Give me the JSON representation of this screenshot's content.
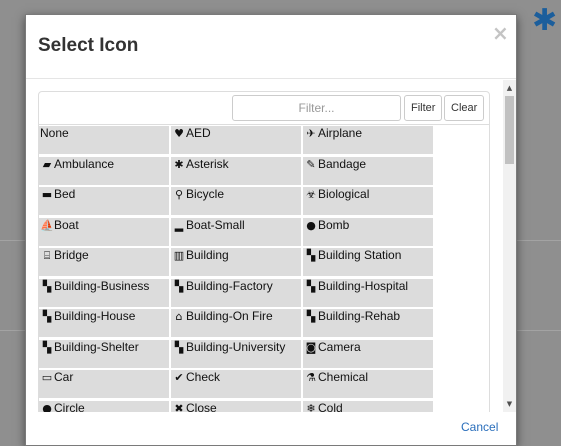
{
  "modal": {
    "title": "Select Icon",
    "close_label": "×",
    "cancel_label": "Cancel"
  },
  "filter": {
    "placeholder": "Filter...",
    "filter_button": "Filter",
    "clear_button": "Clear"
  },
  "icons": [
    {
      "label": "None",
      "icon": ""
    },
    {
      "label": "AED",
      "icon": "heart-pulse-icon"
    },
    {
      "label": "Airplane",
      "icon": "airplane-icon"
    },
    {
      "label": "Ambulance",
      "icon": "ambulance-icon"
    },
    {
      "label": "Asterisk",
      "icon": "asterisk-icon"
    },
    {
      "label": "Bandage",
      "icon": "bandage-icon"
    },
    {
      "label": "Bed",
      "icon": "bed-icon"
    },
    {
      "label": "Bicycle",
      "icon": "bicycle-icon"
    },
    {
      "label": "Biological",
      "icon": "biohazard-icon"
    },
    {
      "label": "Boat",
      "icon": "boat-icon"
    },
    {
      "label": "Boat-Small",
      "icon": "small-boat-icon"
    },
    {
      "label": "Bomb",
      "icon": "bomb-icon"
    },
    {
      "label": "Bridge",
      "icon": "bridge-icon"
    },
    {
      "label": "Building",
      "icon": "building-icon"
    },
    {
      "label": "Building Station",
      "icon": "building-station-icon"
    },
    {
      "label": "Building-Business",
      "icon": "building-business-icon"
    },
    {
      "label": "Building-Factory",
      "icon": "building-factory-icon"
    },
    {
      "label": "Building-Hospital",
      "icon": "building-hospital-icon"
    },
    {
      "label": "Building-House",
      "icon": "building-house-icon"
    },
    {
      "label": "Building-On Fire",
      "icon": "house-icon"
    },
    {
      "label": "Building-Rehab",
      "icon": "building-rehab-icon"
    },
    {
      "label": "Building-Shelter",
      "icon": "building-shelter-icon"
    },
    {
      "label": "Building-University",
      "icon": "building-university-icon"
    },
    {
      "label": "Camera",
      "icon": "camera-icon"
    },
    {
      "label": "Car",
      "icon": "car-icon"
    },
    {
      "label": "Check",
      "icon": "check-icon"
    },
    {
      "label": "Chemical",
      "icon": "chemical-icon"
    },
    {
      "label": "Circle",
      "icon": "circle-icon"
    },
    {
      "label": "Close",
      "icon": "close-icon"
    },
    {
      "label": "Cold",
      "icon": "cold-icon"
    }
  ]
}
